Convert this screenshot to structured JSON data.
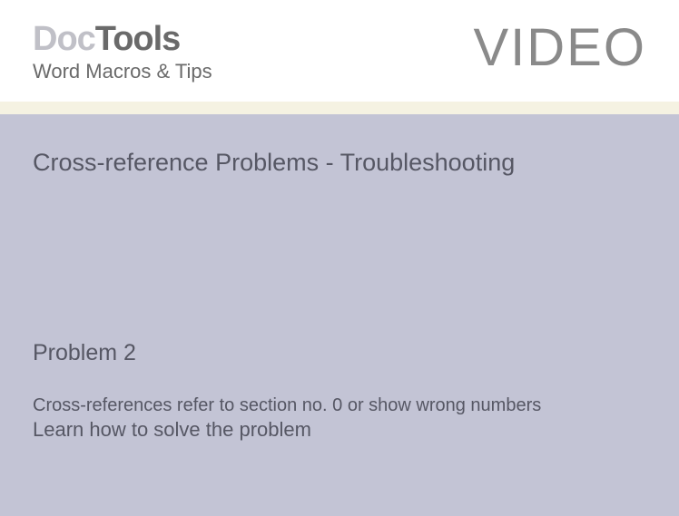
{
  "header": {
    "logo_part1": "Doc",
    "logo_part2": "Tools",
    "tagline": "Word Macros & Tips",
    "video_label": "VIDEO"
  },
  "content": {
    "main_title": "Cross-reference Problems - Troubleshooting",
    "problem_heading": "Problem 2",
    "problem_description": "Cross-references refer to section no. 0 or show wrong numbers",
    "learn_text": "Learn how to solve the problem"
  }
}
